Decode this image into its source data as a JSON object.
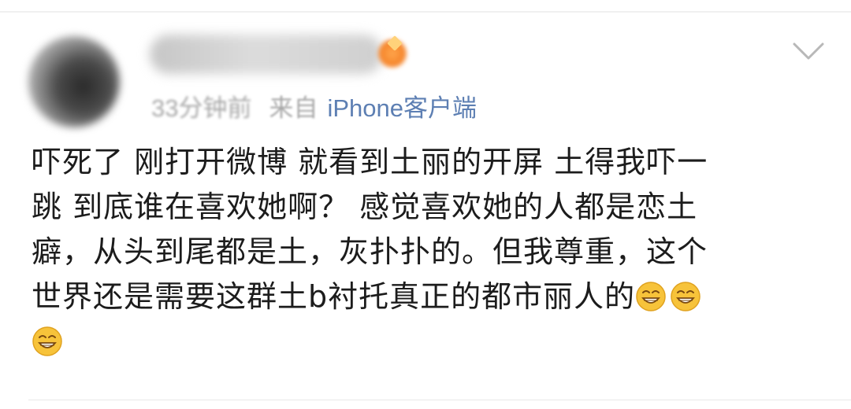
{
  "post": {
    "username": "",
    "time_ago": "33分钟前",
    "source_prefix": "来自",
    "source_client": "iPhone客户端",
    "content_lines": [
      "吓死了 刚打开微博 就看到土丽的开屏 土得我吓一",
      "跳 到底谁在喜欢她啊？ 感觉喜欢她的人都是恋土",
      "癖，从头到尾都是土，灰扑扑的。但我尊重，这个",
      "世界还是需要这群土b衬托真正的都市丽人的"
    ],
    "emoji_names": [
      "grin-emoji",
      "grin-emoji",
      "grin-emoji"
    ],
    "icons": {
      "menu": "chevron-down-icon",
      "avatar": "avatar",
      "badge": "fire-badge-icon"
    },
    "colors": {
      "text": "#1c1c1c",
      "meta_text": "#9a9a9a",
      "client_link": "#5d7fb3",
      "emoji_face": "#f7c33a"
    }
  }
}
